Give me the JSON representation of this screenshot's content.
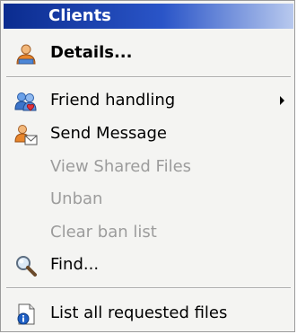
{
  "menu": {
    "header": "Clients",
    "items": [
      {
        "label": "Details...",
        "icon": "client-details-icon",
        "bold": true,
        "enabled": true
      },
      {
        "label": "Friend handling",
        "icon": "friends-icon",
        "enabled": true,
        "has_submenu": true
      },
      {
        "label": "Send Message",
        "icon": "send-message-icon",
        "enabled": true
      },
      {
        "label": "View Shared Files",
        "enabled": false
      },
      {
        "label": "Unban",
        "enabled": false
      },
      {
        "label": "Clear ban list",
        "enabled": false
      },
      {
        "label": "Find...",
        "icon": "magnifier-icon",
        "enabled": true
      },
      {
        "label": "List all requested files",
        "icon": "file-info-icon",
        "enabled": true
      }
    ]
  }
}
